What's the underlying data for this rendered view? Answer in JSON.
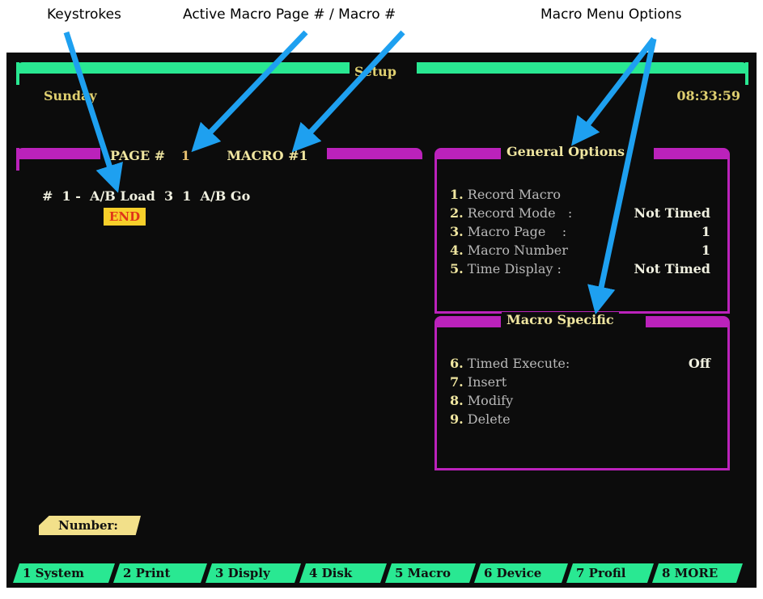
{
  "annotations": {
    "keystrokes": "Keystrokes",
    "active_macro": "Active Macro Page # / Macro #",
    "menu_options": "Macro Menu Options"
  },
  "screen": {
    "title": "Setup",
    "day": "Sunday",
    "clock": "08:33:59",
    "page_label": "PAGE #",
    "page_value": "1",
    "macro_label": "MACRO #1",
    "macro_line": "#  1 -  A/B Load  3  1  A/B Go",
    "end_label": "END",
    "general": {
      "title": "General Options",
      "options": [
        {
          "num": "1.",
          "label": "Record Macro",
          "value": ""
        },
        {
          "num": "2.",
          "label": "Record Mode   :",
          "value": "Not Timed"
        },
        {
          "num": "3.",
          "label": "Macro Page    :",
          "value": "1"
        },
        {
          "num": "4.",
          "label": "Macro Number",
          "value": "1"
        },
        {
          "num": "5.",
          "label": "Time Display :",
          "value": "Not Timed"
        }
      ]
    },
    "specific": {
      "title": "Macro Specific",
      "options": [
        {
          "num": "6.",
          "label": "Timed Execute:",
          "value": "Off"
        },
        {
          "num": "7.",
          "label": "Insert",
          "value": ""
        },
        {
          "num": "8.",
          "label": "Modify",
          "value": ""
        },
        {
          "num": "9.",
          "label": "Delete",
          "value": ""
        }
      ]
    },
    "number_prompt": "Number:",
    "function_keys": [
      "1 System",
      "2 Print",
      "3 Disply",
      "4 Disk",
      "5 Macro",
      "6 Device",
      "7 Profil",
      "8 MORE"
    ]
  },
  "colors": {
    "green_bar": "#29e892",
    "magenta": "#bb22bb",
    "arrow": "#1ea0f0",
    "end_badge": "#f7cf2a"
  }
}
